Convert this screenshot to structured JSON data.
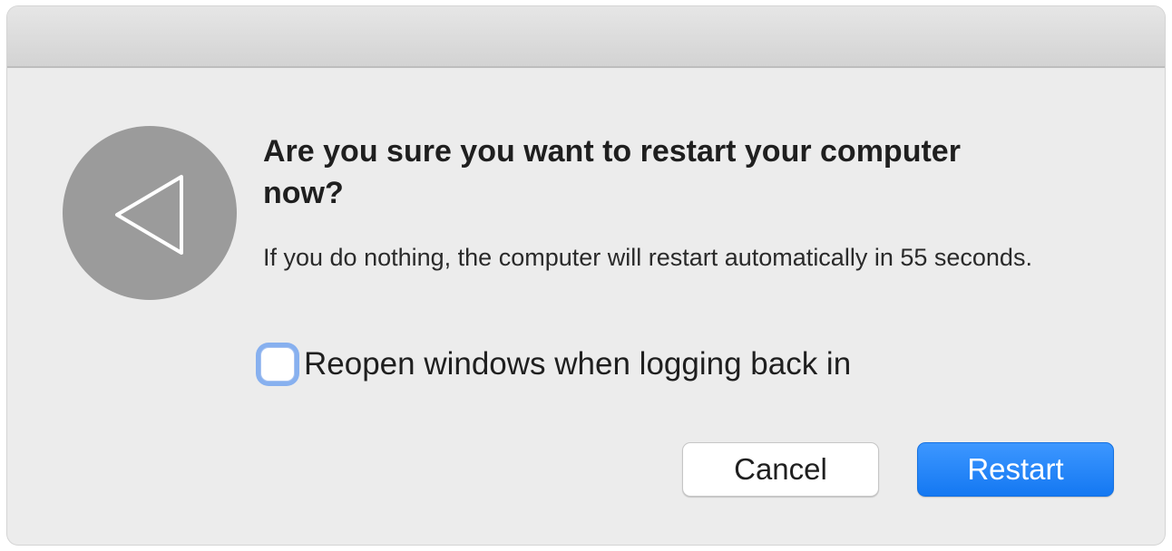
{
  "dialog": {
    "headline": "Are you sure you want to restart your computer now?",
    "message": "If you do nothing, the computer will restart automatically in 55 seconds.",
    "icon": "restart-triangle-icon",
    "checkbox": {
      "label": "Reopen windows when logging back in",
      "checked": false
    },
    "buttons": {
      "cancel_label": "Cancel",
      "restart_label": "Restart"
    }
  },
  "colors": {
    "background": "#ececec",
    "icon_circle": "#9b9b9b",
    "primary_button": "#1a7ff5",
    "focus_ring": "#87b0ef"
  }
}
